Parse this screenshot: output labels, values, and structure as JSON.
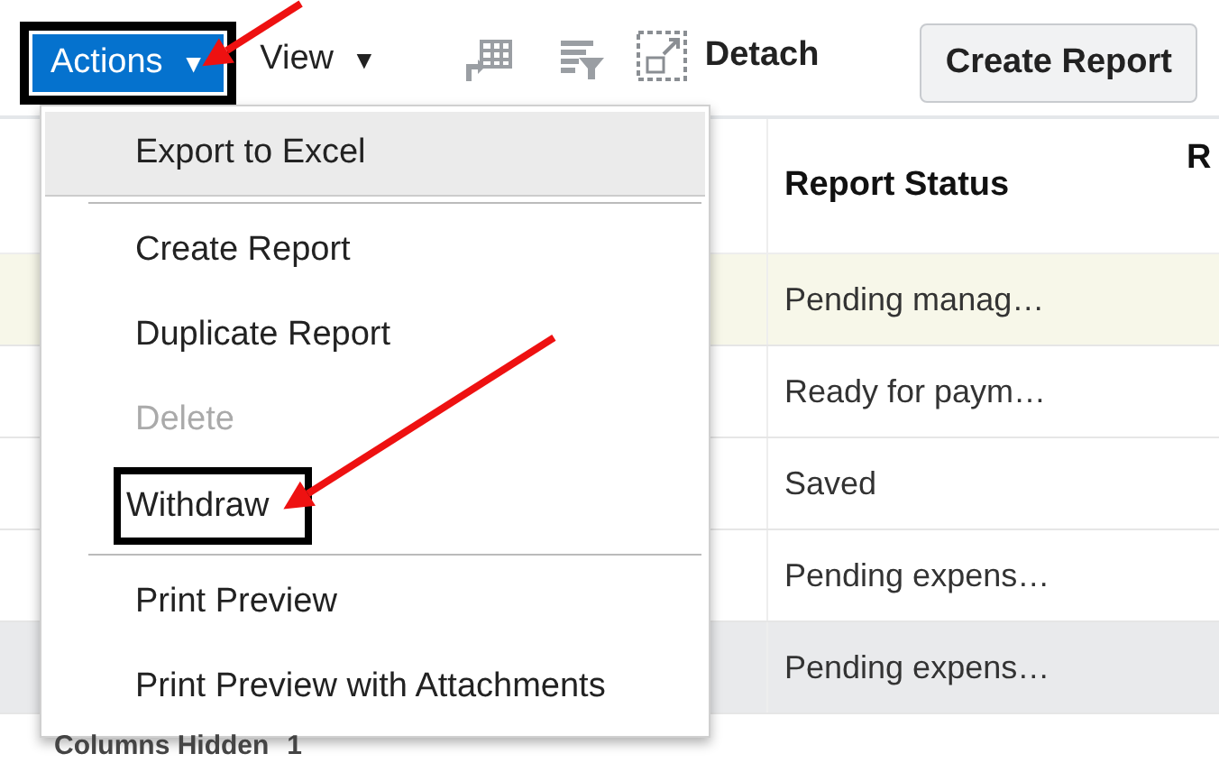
{
  "toolbar": {
    "actions_button": {
      "label": "Actions",
      "caret": "▼",
      "outlined": true
    },
    "view_menu": {
      "label": "View",
      "caret": "▼"
    },
    "icon_buttons": [
      {
        "kind": "freeze",
        "disabled": true
      },
      {
        "kind": "filter",
        "disabled": true
      }
    ],
    "detach": {
      "label": "Detach"
    },
    "create_report": {
      "label": "Create Report"
    }
  },
  "table": {
    "columns": [
      {
        "label": "Report Status"
      },
      {
        "label": "R"
      }
    ],
    "rows": [
      {
        "status": "Pending manag…",
        "highlighted": true,
        "selected": false
      },
      {
        "status": "Ready for paym…",
        "highlighted": false,
        "selected": false
      },
      {
        "status": "Saved",
        "highlighted": false,
        "selected": false
      },
      {
        "status": "Pending expens…",
        "highlighted": false,
        "selected": false
      },
      {
        "status": "Pending expens…",
        "highlighted": false,
        "selected": true
      }
    ]
  },
  "actions_menu": [
    {
      "kind": "item",
      "label": "Export to Excel",
      "hovered": true,
      "disabled": false,
      "outlined": false
    },
    {
      "kind": "divider"
    },
    {
      "kind": "item",
      "label": "Create Report",
      "hovered": false,
      "disabled": false,
      "outlined": false
    },
    {
      "kind": "item",
      "label": "Duplicate Report",
      "hovered": false,
      "disabled": false,
      "outlined": false
    },
    {
      "kind": "item",
      "label": "Delete",
      "hovered": false,
      "disabled": true,
      "outlined": false
    },
    {
      "kind": "item",
      "label": "Withdraw",
      "hovered": false,
      "disabled": false,
      "outlined": true
    },
    {
      "kind": "divider"
    },
    {
      "kind": "item",
      "label": "Print Preview",
      "hovered": false,
      "disabled": false,
      "outlined": false
    },
    {
      "kind": "item",
      "label": "Print Preview with Attachments",
      "hovered": false,
      "disabled": false,
      "outlined": false
    }
  ],
  "footer": {
    "label": "Columns Hidden",
    "count": "1"
  }
}
